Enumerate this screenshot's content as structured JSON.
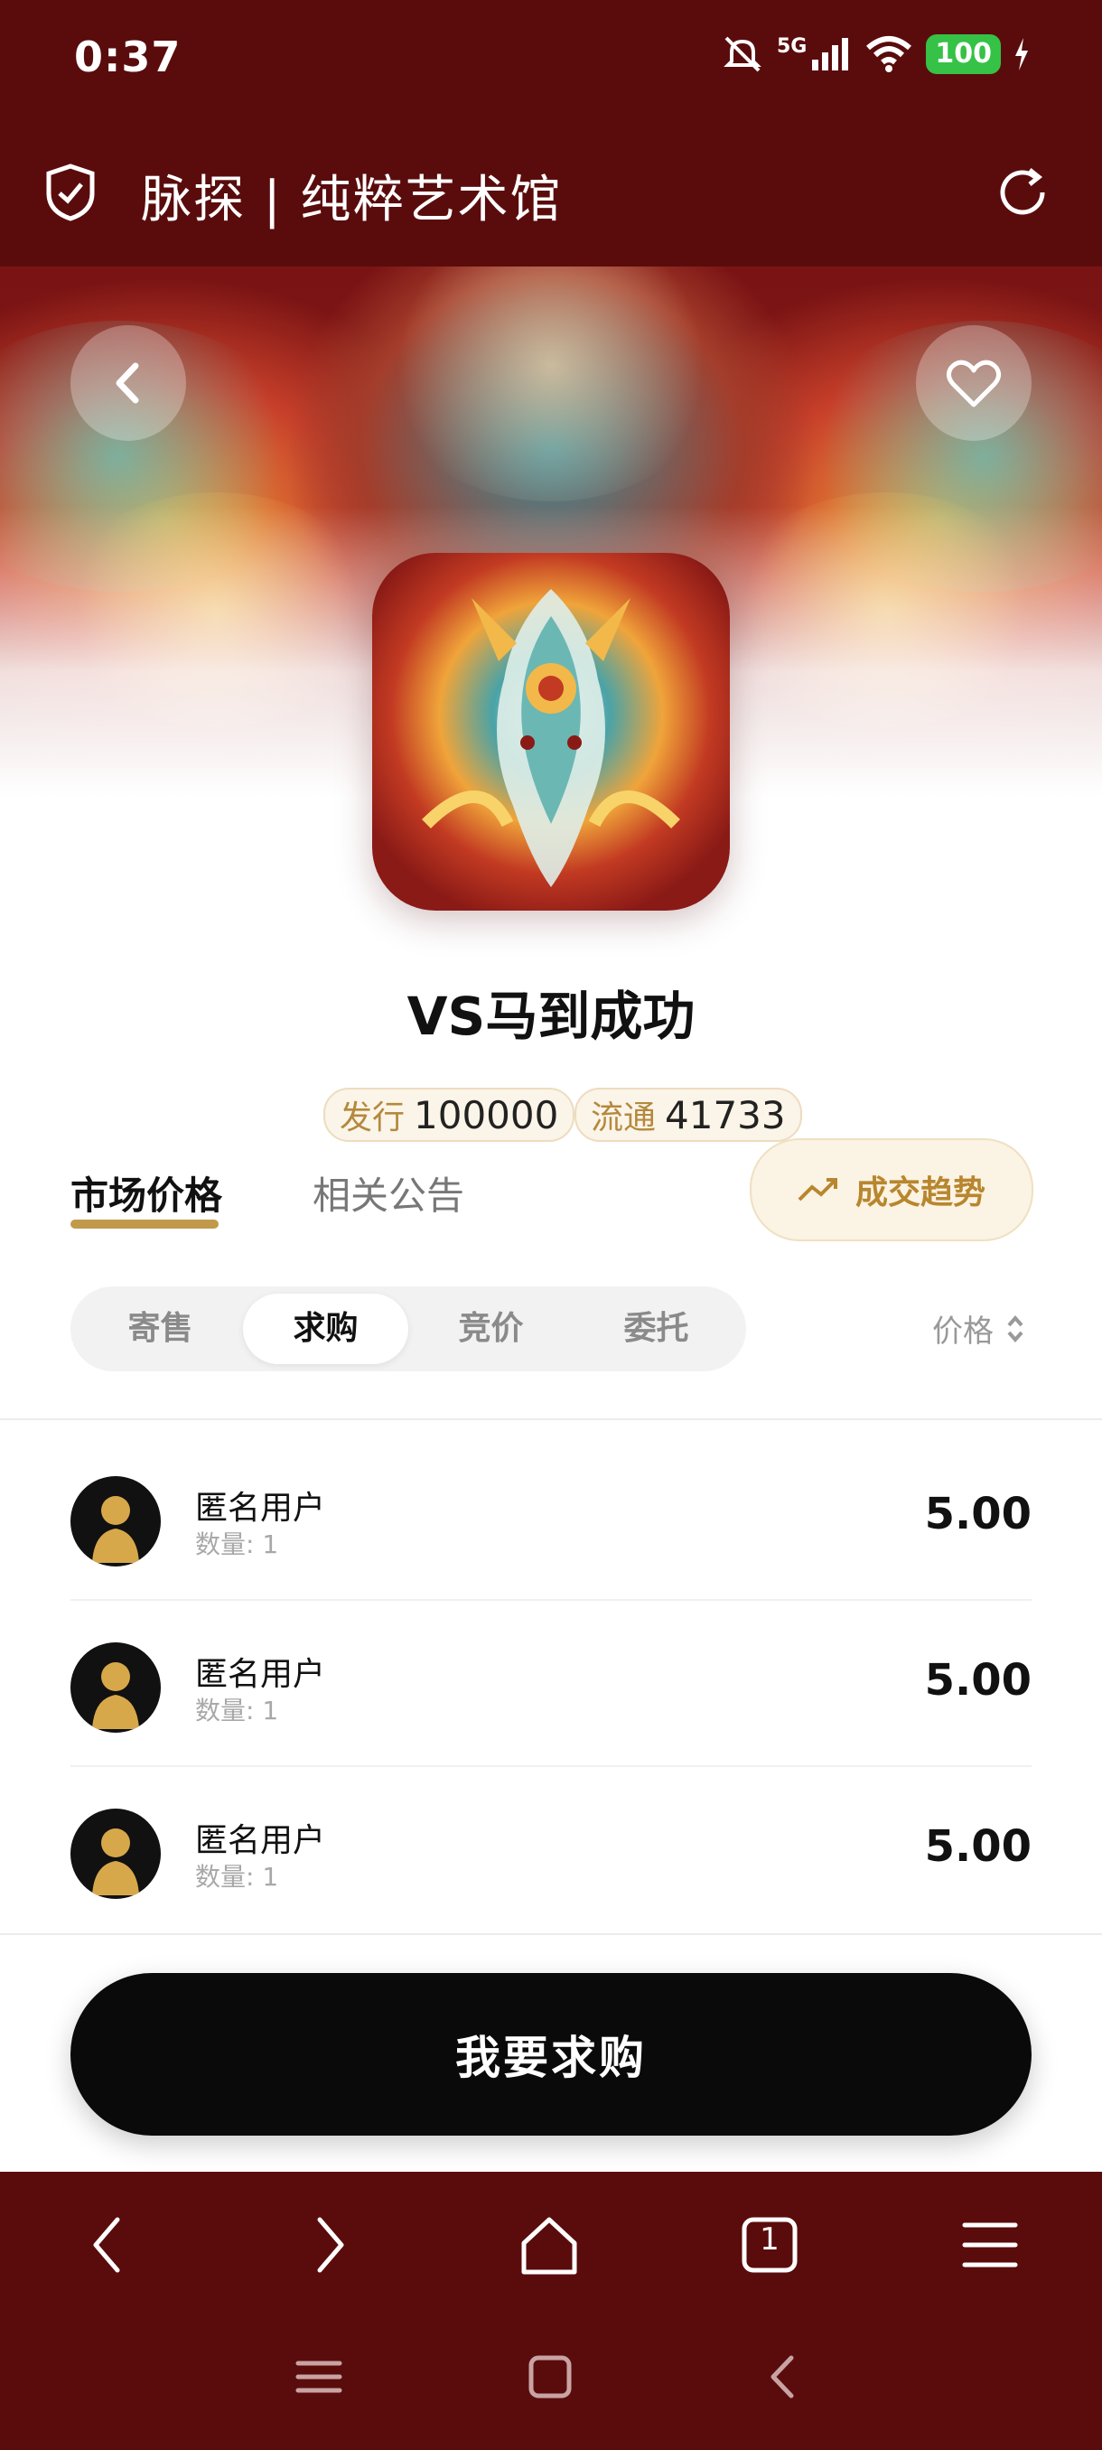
{
  "status_bar": {
    "time": "0:37",
    "network": "5G",
    "battery": "100"
  },
  "header": {
    "title": "脉探 | 纯粹艺术馆"
  },
  "colors": {
    "brand_dark": "#5a0c0c",
    "gold": "#c09a4a",
    "battery_green": "#35c246"
  },
  "nft": {
    "name": "VS马到成功",
    "issue_label": "发行",
    "issue_value": "100000",
    "circulation_label": "流通",
    "circulation_value": "41733"
  },
  "tabs": [
    {
      "label": "市场价格",
      "active": true
    },
    {
      "label": "相关公告",
      "active": false
    }
  ],
  "trend_button": {
    "label": "成交趋势"
  },
  "segments": [
    {
      "label": "寄售",
      "active": false
    },
    {
      "label": "求购",
      "active": true
    },
    {
      "label": "竞价",
      "active": false
    },
    {
      "label": "委托",
      "active": false
    }
  ],
  "sort": {
    "label": "价格"
  },
  "orders": [
    {
      "user": "匿名用户",
      "quantity": "数量: 1",
      "price": "5.00"
    },
    {
      "user": "匿名用户",
      "quantity": "数量: 1",
      "price": "5.00"
    },
    {
      "user": "匿名用户",
      "quantity": "数量: 1",
      "price": "5.00"
    }
  ],
  "action": {
    "label": "我要求购"
  },
  "browser_nav": {
    "tab_count": "1"
  }
}
